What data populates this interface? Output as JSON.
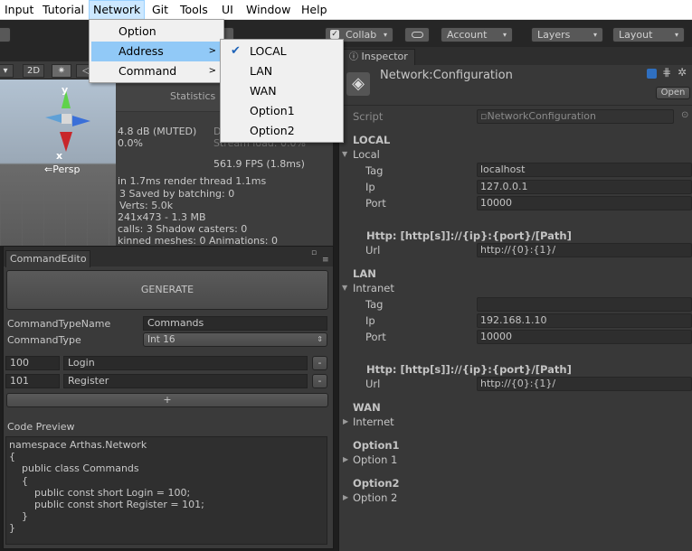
{
  "menubar": [
    "Input",
    "Tutorial",
    "Network",
    "Git",
    "Tools",
    "UI",
    "Window",
    "Help"
  ],
  "network_menu": [
    {
      "label": "Option",
      "submenu": false
    },
    {
      "label": "Address",
      "submenu": true
    },
    {
      "label": "Command",
      "submenu": true
    }
  ],
  "address_menu": [
    {
      "label": "LOCAL",
      "checked": true
    },
    {
      "label": "LAN",
      "checked": false
    },
    {
      "label": "WAN",
      "checked": false
    },
    {
      "label": "Option1",
      "checked": false
    },
    {
      "label": "Option2",
      "checked": false
    }
  ],
  "toolbar": {
    "collab": "Collab",
    "account": "Account",
    "layers": "Layers",
    "layout": "Layout"
  },
  "scene": {
    "mode_2d": "2D",
    "persp": "Persp",
    "axis_y": "y",
    "axis_x": "x"
  },
  "statistics": {
    "title": "Statistics",
    "lines": [
      "4.8 dB (MUTED)",
      "0.0%",
      "561.9 FPS (1.8ms)",
      "in 1.7ms  render thread 1.1ms",
      "3        Saved by batching: 0",
      "          Verts: 5.0k",
      "241x473 - 1.3 MB",
      "calls: 3     Shadow casters: 0",
      "kinned meshes: 0  Animations: 0"
    ],
    "ghost_1": "D",
    "ghost_2": "Stream load: 0.0%"
  },
  "command_editor": {
    "tab": "CommandEdito",
    "generate": "GENERATE",
    "type_name_label": "CommandTypeName",
    "type_name_value": "Commands",
    "type_label": "CommandType",
    "type_value": "Int 16",
    "rows": [
      {
        "id": "100",
        "name": "Login"
      },
      {
        "id": "101",
        "name": "Register"
      }
    ],
    "remove": "-",
    "add": "+",
    "preview_label": "Code Preview",
    "code": [
      "namespace Arthas.Network",
      "{",
      "    public class Commands",
      "    {",
      "        public const short Login = 100;",
      "        public const short Register = 101;",
      "    }",
      "}"
    ]
  },
  "inspector": {
    "tab": "Inspector",
    "title": "Network:Configuration",
    "open": "Open",
    "script_label": "Script",
    "script_value": "NetworkConfiguration",
    "local_header": "LOCAL",
    "local_group": "Local",
    "tag_label": "Tag",
    "ip_label": "Ip",
    "port_label": "Port",
    "url_label": "Url",
    "local_tag": "localhost",
    "local_ip": "127.0.0.1",
    "local_port": "10000",
    "http_hint": "Http: [http[s]]://{ip}:{port}/[Path]",
    "url_value": "http://{0}:{1}/",
    "lan_header": "LAN",
    "lan_group": "Intranet",
    "lan_tag": "",
    "lan_ip": "192.168.1.10",
    "lan_port": "10000",
    "wan_header": "WAN",
    "wan_group": "Internet",
    "opt1_header": "Option1",
    "opt1_group": "Option 1",
    "opt2_header": "Option2",
    "opt2_group": "Option 2"
  },
  "colors": {
    "menu_highlight": "#91c9f7",
    "check": "#1e63b8",
    "panel": "#383838"
  }
}
